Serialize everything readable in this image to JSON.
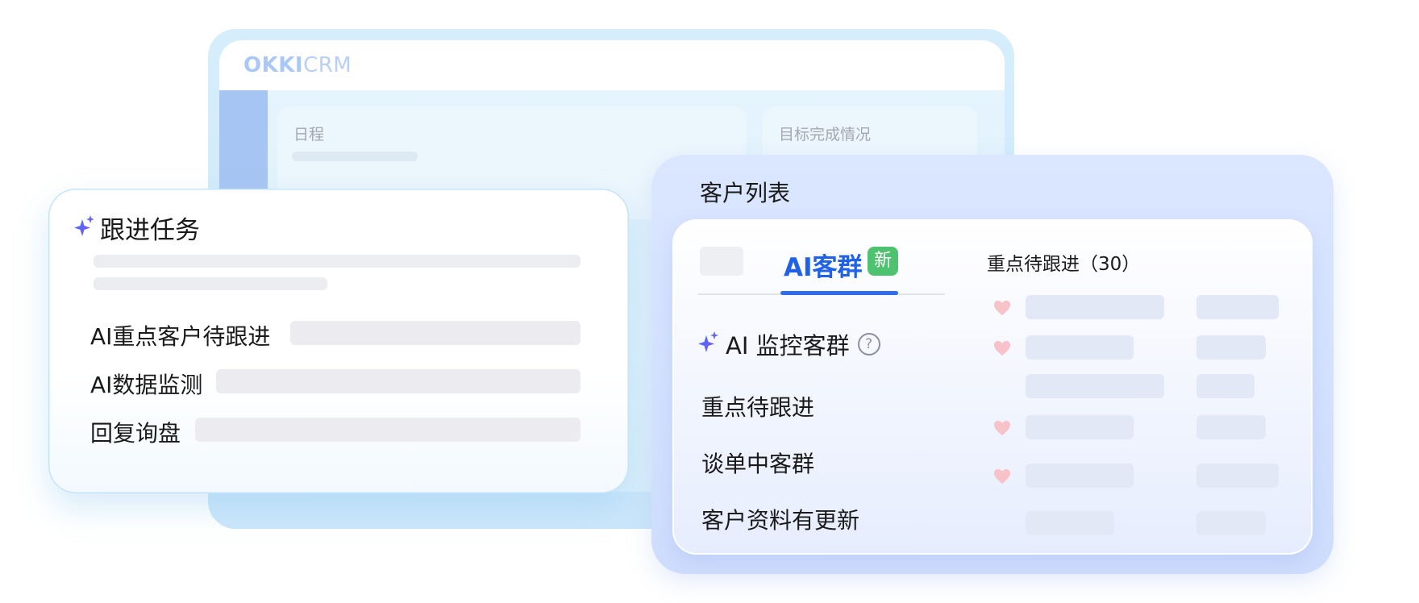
{
  "crm_window": {
    "logo_okki": "OKKI",
    "logo_crm": "CRM",
    "card_schedule_title": "日程",
    "card_goal_title": "目标完成情况"
  },
  "task_card": {
    "title": "跟进任务",
    "items": [
      {
        "label": "AI重点客户待跟进"
      },
      {
        "label": "AI数据监测"
      },
      {
        "label": "回复询盘"
      }
    ]
  },
  "customer_list": {
    "heading": "客户列表",
    "tab_ai_label": "AI客群",
    "tab_badge": "新",
    "ai_monitor_label": "AI 监控客群",
    "help_icon_glyph": "?",
    "groups": [
      {
        "label": "重点待跟进"
      },
      {
        "label": "谈单中客群"
      },
      {
        "label": "客户资料有更新"
      }
    ],
    "follow_heading": "重点待跟进（30）"
  },
  "colors": {
    "accent_blue": "#1f62e8",
    "badge_green": "#4fc26f",
    "heart_pink": "#f7c3c9",
    "sparkle_purple": "#7a55f0"
  }
}
